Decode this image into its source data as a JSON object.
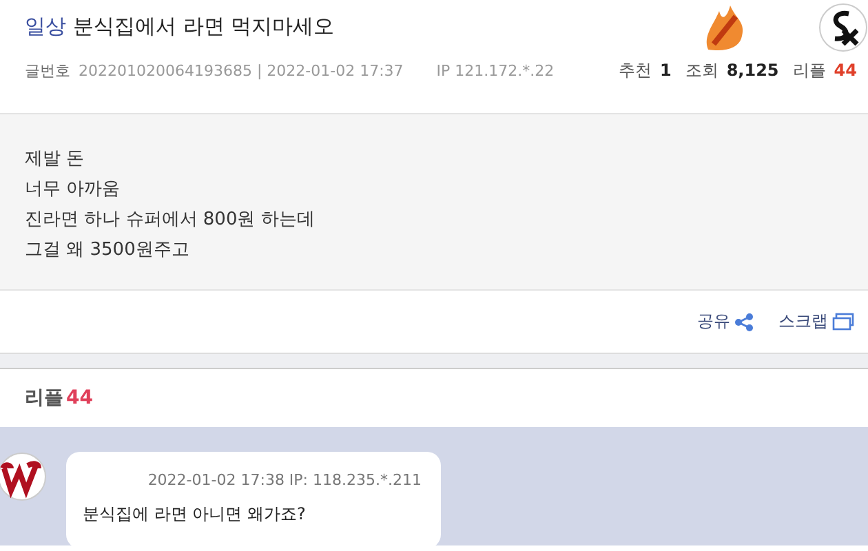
{
  "post": {
    "category": "일상",
    "title": "분식집에서 라면 먹지마세오",
    "number_label": "글번호",
    "number": "202201020064193685 | 2022-01-02 17:37",
    "ip": "IP 121.172.*.22",
    "stats": [
      {
        "label": "추천",
        "value": "1",
        "kind": "plain"
      },
      {
        "label": "조회",
        "value": "8,125",
        "kind": "plain"
      },
      {
        "label": "리플",
        "value": "44",
        "kind": "accent"
      }
    ],
    "body": [
      "제발 돈",
      "너무 아까움",
      "진라면 하나 슈퍼에서 800원 하는데",
      "그걸 왜 3500원주고"
    ],
    "actions": [
      {
        "label": "공유",
        "kind": "share"
      },
      {
        "label": "스크랩",
        "kind": "scrap"
      }
    ]
  },
  "replies": {
    "label": "리플",
    "count": "44",
    "items": [
      {
        "meta": "2022-01-02 17:38 IP: 118.235.*.211",
        "text": "분식집에 라면 아니면 왜가죠?"
      }
    ]
  }
}
